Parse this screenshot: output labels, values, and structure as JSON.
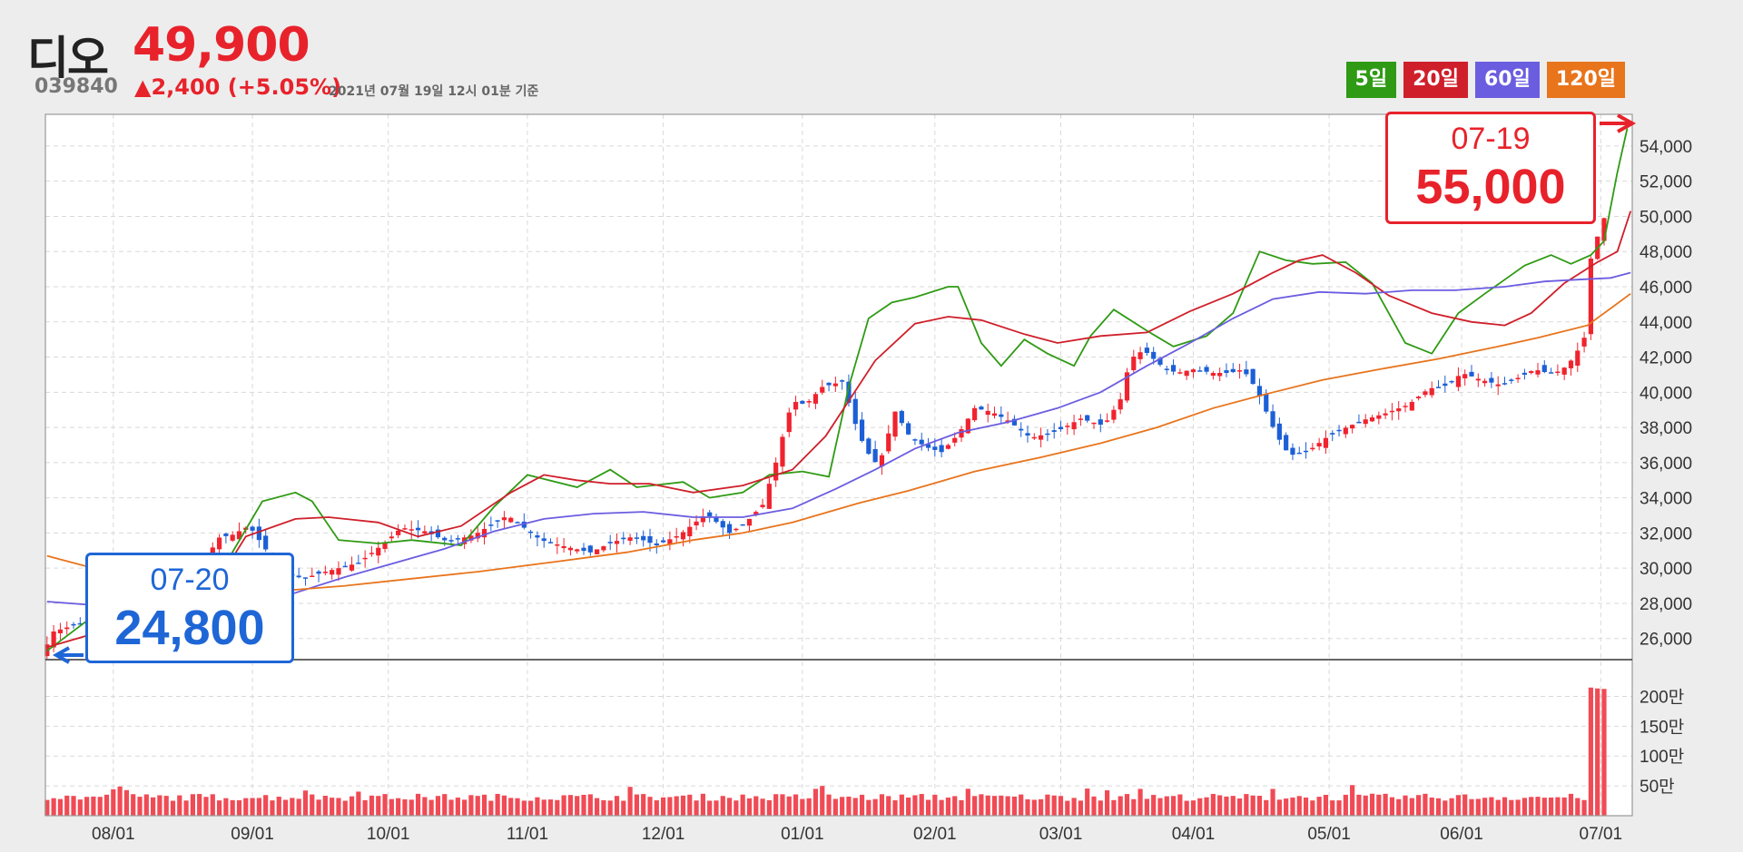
{
  "header": {
    "name": "디오",
    "price": "49,900",
    "code": "039840",
    "change": "▲2,400 (+5.05%)",
    "timestamp": "2021년 07월 19일 12시 01분 기준"
  },
  "legend": [
    {
      "label": "5일",
      "color": "#2f9a14"
    },
    {
      "label": "20일",
      "color": "#cf1f2a"
    },
    {
      "label": "60일",
      "color": "#6b5de0"
    },
    {
      "label": "120일",
      "color": "#e8741c"
    }
  ],
  "annotations": {
    "min": {
      "date": "07-20",
      "value": "24,800"
    },
    "max": {
      "date": "07-19",
      "value": "55,000"
    }
  },
  "chart_data": {
    "type": "candlestick",
    "x_ticks": [
      "08/01",
      "09/01",
      "10/01",
      "11/01",
      "12/01",
      "01/01",
      "02/01",
      "03/01",
      "04/01",
      "05/01",
      "06/01",
      "07/01"
    ],
    "price_axis": {
      "ticks": [
        "54,000",
        "52,000",
        "50,000",
        "48,000",
        "46,000",
        "44,000",
        "42,000",
        "40,000",
        "38,000",
        "36,000",
        "34,000",
        "32,000",
        "30,000",
        "28,000",
        "26,000"
      ],
      "ylim": [
        24800,
        55800
      ]
    },
    "volume_axis": {
      "ticks": [
        "200만",
        "150만",
        "100만",
        "50만"
      ],
      "ylim": [
        0,
        2600000
      ]
    },
    "close_path": [
      [
        0,
        25300
      ],
      [
        3,
        26400
      ],
      [
        10,
        26800
      ],
      [
        22,
        27100
      ],
      [
        38,
        27300
      ],
      [
        45,
        28200
      ],
      [
        48,
        29600
      ],
      [
        52,
        31700
      ],
      [
        57,
        31900
      ],
      [
        62,
        32400
      ],
      [
        68,
        30800
      ],
      [
        72,
        29900
      ],
      [
        78,
        29400
      ],
      [
        85,
        29800
      ],
      [
        95,
        30300
      ],
      [
        102,
        31300
      ],
      [
        108,
        32300
      ],
      [
        115,
        32100
      ],
      [
        122,
        31500
      ],
      [
        130,
        31900
      ],
      [
        140,
        33000
      ],
      [
        150,
        31600
      ],
      [
        158,
        31200
      ],
      [
        165,
        30900
      ],
      [
        172,
        31500
      ],
      [
        178,
        31800
      ],
      [
        185,
        31300
      ],
      [
        192,
        31900
      ],
      [
        200,
        33100
      ],
      [
        207,
        32000
      ],
      [
        212,
        32600
      ],
      [
        217,
        33600
      ],
      [
        221,
        36000
      ],
      [
        224,
        38200
      ],
      [
        226,
        39500
      ],
      [
        230,
        39300
      ],
      [
        235,
        40300
      ],
      [
        241,
        40600
      ],
      [
        246,
        37600
      ],
      [
        249,
        36500
      ],
      [
        252,
        35800
      ],
      [
        257,
        38900
      ],
      [
        261,
        37600
      ],
      [
        266,
        36900
      ],
      [
        271,
        36600
      ],
      [
        276,
        37600
      ],
      [
        281,
        39100
      ],
      [
        286,
        38900
      ],
      [
        291,
        38400
      ],
      [
        298,
        37400
      ],
      [
        306,
        37800
      ],
      [
        313,
        38500
      ],
      [
        320,
        38100
      ],
      [
        325,
        39600
      ],
      [
        328,
        41900
      ],
      [
        332,
        42400
      ],
      [
        338,
        41400
      ],
      [
        342,
        41100
      ],
      [
        347,
        41300
      ],
      [
        353,
        41100
      ],
      [
        358,
        41100
      ],
      [
        362,
        41300
      ],
      [
        366,
        40200
      ],
      [
        372,
        37600
      ],
      [
        376,
        36400
      ],
      [
        382,
        36700
      ],
      [
        387,
        37400
      ],
      [
        392,
        37900
      ],
      [
        398,
        38400
      ],
      [
        405,
        38800
      ],
      [
        412,
        39300
      ],
      [
        418,
        40200
      ],
      [
        424,
        40400
      ],
      [
        428,
        41100
      ],
      [
        434,
        40700
      ],
      [
        440,
        40400
      ],
      [
        446,
        40900
      ],
      [
        450,
        41300
      ],
      [
        454,
        41100
      ],
      [
        458,
        41200
      ],
      [
        462,
        42000
      ],
      [
        465,
        43100
      ],
      [
        466,
        47400
      ],
      [
        468,
        47800
      ],
      [
        470,
        49900
      ]
    ],
    "series": [
      {
        "name": "5일",
        "color": "#2f9a14",
        "points": [
          [
            0,
            25300
          ],
          [
            12,
            27000
          ],
          [
            28,
            29500
          ],
          [
            48,
            29300
          ],
          [
            55,
            30600
          ],
          [
            65,
            33800
          ],
          [
            75,
            34300
          ],
          [
            80,
            33800
          ],
          [
            88,
            31600
          ],
          [
            100,
            31400
          ],
          [
            110,
            31600
          ],
          [
            125,
            31300
          ],
          [
            135,
            33500
          ],
          [
            145,
            35300
          ],
          [
            160,
            34600
          ],
          [
            170,
            35600
          ],
          [
            178,
            34600
          ],
          [
            192,
            34900
          ],
          [
            200,
            34000
          ],
          [
            210,
            34300
          ],
          [
            218,
            35300
          ],
          [
            228,
            35500
          ],
          [
            236,
            35200
          ],
          [
            242,
            40300
          ],
          [
            248,
            44200
          ],
          [
            255,
            45100
          ],
          [
            262,
            45400
          ],
          [
            272,
            46000
          ],
          [
            275,
            46000
          ],
          [
            282,
            42800
          ],
          [
            288,
            41500
          ],
          [
            295,
            43000
          ],
          [
            302,
            42200
          ],
          [
            310,
            41500
          ],
          [
            315,
            43200
          ],
          [
            322,
            44700
          ],
          [
            332,
            43500
          ],
          [
            340,
            42600
          ],
          [
            350,
            43200
          ],
          [
            358,
            44500
          ],
          [
            366,
            48000
          ],
          [
            374,
            47500
          ],
          [
            382,
            47300
          ],
          [
            392,
            47400
          ],
          [
            400,
            46200
          ],
          [
            410,
            42800
          ],
          [
            418,
            42200
          ],
          [
            426,
            44500
          ],
          [
            434,
            45600
          ],
          [
            446,
            47200
          ],
          [
            454,
            47800
          ],
          [
            460,
            47300
          ],
          [
            466,
            47800
          ],
          [
            470,
            48600
          ],
          [
            474,
            52500
          ],
          [
            477,
            55000
          ]
        ]
      },
      {
        "name": "20일",
        "color": "#cf1f2a",
        "points": [
          [
            0,
            25500
          ],
          [
            20,
            26600
          ],
          [
            38,
            27600
          ],
          [
            48,
            28200
          ],
          [
            60,
            31800
          ],
          [
            75,
            32800
          ],
          [
            85,
            32900
          ],
          [
            100,
            32600
          ],
          [
            112,
            31800
          ],
          [
            125,
            32400
          ],
          [
            140,
            34300
          ],
          [
            150,
            35300
          ],
          [
            160,
            35000
          ],
          [
            170,
            34800
          ],
          [
            182,
            34800
          ],
          [
            195,
            34300
          ],
          [
            210,
            34700
          ],
          [
            225,
            35600
          ],
          [
            235,
            37500
          ],
          [
            250,
            41800
          ],
          [
            262,
            43900
          ],
          [
            272,
            44300
          ],
          [
            282,
            44100
          ],
          [
            295,
            43300
          ],
          [
            305,
            42800
          ],
          [
            318,
            43200
          ],
          [
            332,
            43400
          ],
          [
            345,
            44600
          ],
          [
            358,
            45600
          ],
          [
            370,
            46800
          ],
          [
            378,
            47500
          ],
          [
            385,
            47800
          ],
          [
            395,
            46800
          ],
          [
            405,
            45500
          ],
          [
            418,
            44500
          ],
          [
            430,
            44000
          ],
          [
            440,
            43800
          ],
          [
            448,
            44500
          ],
          [
            458,
            46200
          ],
          [
            468,
            47400
          ],
          [
            474,
            48000
          ],
          [
            478,
            50300
          ]
        ]
      },
      {
        "name": "60일",
        "color": "#6b5de0",
        "points": [
          [
            0,
            28100
          ],
          [
            28,
            27700
          ],
          [
            48,
            27200
          ],
          [
            60,
            27700
          ],
          [
            75,
            28600
          ],
          [
            90,
            29500
          ],
          [
            105,
            30300
          ],
          [
            120,
            31100
          ],
          [
            135,
            32100
          ],
          [
            150,
            32800
          ],
          [
            165,
            33100
          ],
          [
            180,
            33200
          ],
          [
            195,
            32900
          ],
          [
            210,
            32900
          ],
          [
            225,
            33400
          ],
          [
            238,
            34500
          ],
          [
            250,
            35600
          ],
          [
            262,
            36800
          ],
          [
            275,
            37700
          ],
          [
            290,
            38300
          ],
          [
            305,
            39100
          ],
          [
            318,
            40000
          ],
          [
            332,
            41500
          ],
          [
            345,
            42800
          ],
          [
            358,
            44200
          ],
          [
            370,
            45300
          ],
          [
            384,
            45700
          ],
          [
            398,
            45600
          ],
          [
            412,
            45800
          ],
          [
            425,
            45800
          ],
          [
            440,
            46000
          ],
          [
            452,
            46300
          ],
          [
            462,
            46400
          ],
          [
            472,
            46500
          ],
          [
            478,
            46800
          ]
        ]
      },
      {
        "name": "120일",
        "color": "#e8741c",
        "points": [
          [
            0,
            30700
          ],
          [
            12,
            30100
          ],
          [
            20,
            29800
          ],
          [
            28,
            29500
          ],
          [
            40,
            28700
          ],
          [
            55,
            28200
          ],
          [
            70,
            28700
          ],
          [
            90,
            29000
          ],
          [
            110,
            29400
          ],
          [
            130,
            29800
          ],
          [
            155,
            30400
          ],
          [
            175,
            30900
          ],
          [
            195,
            31600
          ],
          [
            210,
            32000
          ],
          [
            225,
            32600
          ],
          [
            245,
            33700
          ],
          [
            260,
            34400
          ],
          [
            280,
            35500
          ],
          [
            300,
            36300
          ],
          [
            318,
            37100
          ],
          [
            335,
            38000
          ],
          [
            352,
            39100
          ],
          [
            368,
            39900
          ],
          [
            385,
            40700
          ],
          [
            402,
            41300
          ],
          [
            420,
            41900
          ],
          [
            438,
            42600
          ],
          [
            450,
            43100
          ],
          [
            465,
            43800
          ],
          [
            478,
            45600
          ]
        ]
      }
    ]
  }
}
